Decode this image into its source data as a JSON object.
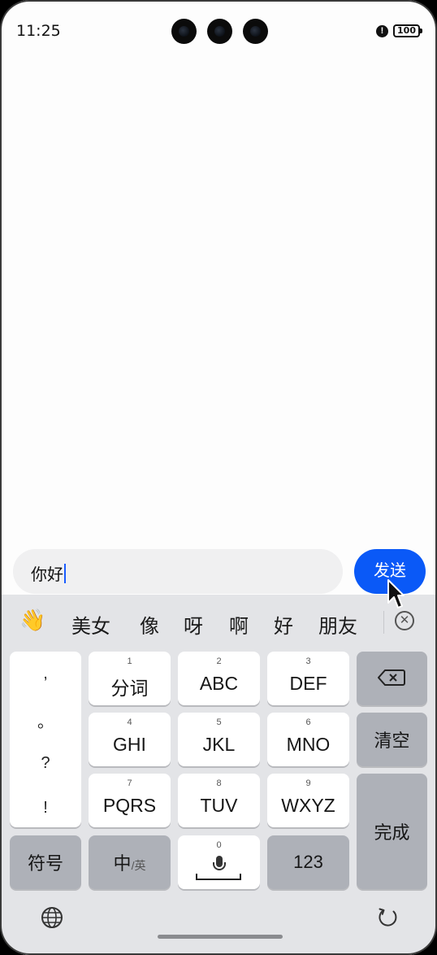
{
  "status_bar": {
    "time": "11:25",
    "battery": "100",
    "alert": "!"
  },
  "message_input": {
    "value": "你好"
  },
  "send_button": {
    "label": "发送"
  },
  "keyboard": {
    "candidates": {
      "emoji": "👋",
      "items": [
        "美女",
        "像",
        "呀",
        "啊",
        "好",
        "朋友"
      ],
      "close": "✕"
    },
    "punctuation": [
      ",",
      "。",
      "?",
      "!"
    ],
    "keys": {
      "k1": {
        "num": "1",
        "label": "分词"
      },
      "k2": {
        "num": "2",
        "label": "ABC"
      },
      "k3": {
        "num": "3",
        "label": "DEF"
      },
      "k4": {
        "num": "4",
        "label": "GHI"
      },
      "k5": {
        "num": "5",
        "label": "JKL"
      },
      "k6": {
        "num": "6",
        "label": "MNO"
      },
      "k7": {
        "num": "7",
        "label": "PQRS"
      },
      "k8": {
        "num": "8",
        "label": "TUV"
      },
      "k9": {
        "num": "9",
        "label": "WXYZ"
      },
      "k0": {
        "num": "0"
      }
    },
    "clear_label": "清空",
    "done_label": "完成",
    "symbols_label": "符号",
    "lang_main": "中",
    "lang_sub": "/英",
    "numeric_label": "123"
  }
}
